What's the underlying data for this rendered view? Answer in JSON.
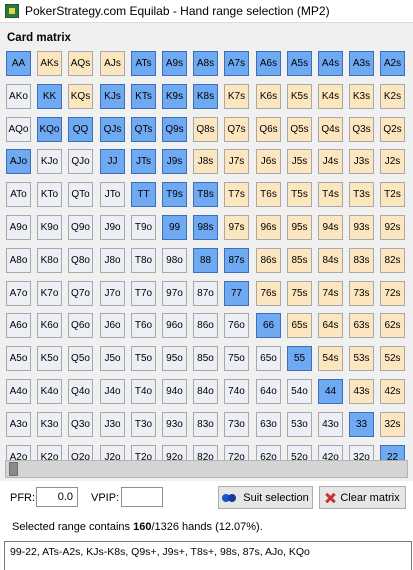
{
  "window": {
    "title": "PokerStrategy.com Equilab - Hand range selection (MP2)",
    "icon": "equilab-app-icon"
  },
  "card_matrix": {
    "label": "Card matrix",
    "ranks": [
      "A",
      "K",
      "Q",
      "J",
      "T",
      "9",
      "8",
      "7",
      "6",
      "5",
      "4",
      "3",
      "2"
    ],
    "selected": [
      "AA",
      "KK",
      "QQ",
      "JJ",
      "TT",
      "99",
      "88",
      "77",
      "66",
      "55",
      "44",
      "33",
      "22",
      "ATs",
      "A9s",
      "A8s",
      "A7s",
      "A6s",
      "A5s",
      "A4s",
      "A3s",
      "A2s",
      "KJs",
      "KTs",
      "K9s",
      "K8s",
      "QJs",
      "QTs",
      "Q9s",
      "JTs",
      "J9s",
      "T9s",
      "T8s",
      "98s",
      "87s",
      "AJo",
      "KQo"
    ],
    "colors": {
      "pair": "#c8dcc4",
      "suited": "#fce6bf",
      "offsuit": "#eceff6",
      "selected": "#6ea9f2"
    }
  },
  "slider": {
    "value": 0
  },
  "pfr": {
    "label": "PFR:",
    "value": "0.0"
  },
  "vpip": {
    "label": "VPIP:",
    "value": ""
  },
  "buttons": {
    "suit_selection": "Suit selection",
    "clear_matrix": "Clear matrix"
  },
  "status": {
    "prefix": "Selected range contains ",
    "count": "160",
    "suffix": "/1326 hands (12.07%)."
  },
  "range_text": "99-22, ATs-A2s, KJs-K8s, Q9s+, J9s+, T8s+, 98s, 87s, AJo, KQo"
}
